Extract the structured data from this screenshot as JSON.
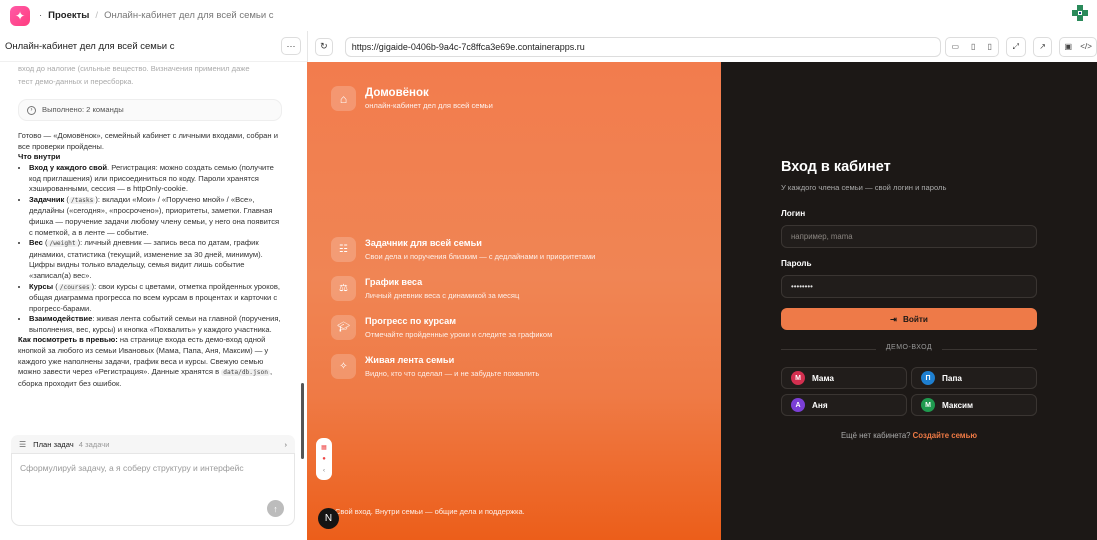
{
  "topbar": {
    "dot": "·",
    "projects": "Проекты",
    "separator": "/",
    "current": "Онлайн-кабинет дел для всей семьи с"
  },
  "left": {
    "title": "Онлайн-кабинет дел для всей семьи с",
    "dots": "···",
    "faded_1": "вход до налогие (сильные вещество. Визначения применил даже",
    "faded_2": "тест демо-данных и пересборка.",
    "done": "Выполнено: 2 команды",
    "intro": "Готово — «Домовёнок», семейный кабинет с личными входами, собран и все проверки пройдены.",
    "what_inside": "Что внутри",
    "items": [
      {
        "bold": "Вход у каждого свой",
        "text": ". Регистрация: можно создать семью (получите код приглашения) или присоединиться по коду. Пароли хранятся хэшированными, сессия — в httpOnly-cookie."
      },
      {
        "bold": "Задачник",
        "code": "/tasks",
        "text": ": вкладки «Мои» / «Поручено мной» / «Все», дедлайны («сегодня», «просрочено»), приоритеты, заметки. Главная фишка — поручение задачи любому члену семьи, у него она появится с пометкой, а в ленте — событие."
      },
      {
        "bold": "Вес",
        "code": "/weight",
        "text": ": личный дневник — запись веса по датам, график динамики, статистика (текущий, изменение за 30 дней, минимум). Цифры видны только владельцу, семья видит лишь событие «записал(а) вес»."
      },
      {
        "bold": "Курсы",
        "code": "/courses",
        "text": ": свои курсы с цветами, отметка пройденных уроков, общая диаграмма прогресса по всем курсам в процентах и карточки с прогресс-барами."
      },
      {
        "bold": "Взаимодействие",
        "text": ": живая лента событий семьи на главной (поручения, выполнения, вес, курсы) и кнопка «Похвалить» у каждого участника."
      }
    ],
    "howto_bold": "Как посмотреть в превью:",
    "howto_text": " на странице входа есть демо-вход одной кнопкой за любого из семьи Ивановых (Мама, Папа, Аня, Максим) — у каждого уже наполнены задачи, график веса и курсы. Свежую семью можно завести через «Регистрация». Данные хранятся в ",
    "howto_code": "data/db.json",
    "howto_end": ", сборка проходит без ошибок.",
    "plan_label": "План задач",
    "plan_count": "4 задачи",
    "input_placeholder": "Сформулируй задачу, а я соберу структуру и интерфейс"
  },
  "browser": {
    "url": "https://gigaide-0406b-9a4c-7c8ffca3e69e.containerapps.ru"
  },
  "brand": {
    "name": "Домовёнок",
    "sub": "онлайн-кабинет дел для всей семьи"
  },
  "features": [
    {
      "icon": "list-icon",
      "title": "Задачник для всей семьи",
      "desc": "Свои дела и поручения близким — с дедлайнами и приоритетами"
    },
    {
      "icon": "scale-icon",
      "title": "График веса",
      "desc": "Личный дневник веса с динамикой за месяц"
    },
    {
      "icon": "graduation-icon",
      "title": "Прогресс по курсам",
      "desc": "Отмечайте пройденные уроки и следите за графиком"
    },
    {
      "icon": "sparkle-icon",
      "title": "Живая лента семьи",
      "desc": "Видно, кто что сделал — и не забудьте похвалить"
    }
  ],
  "footer": "Свой вход. Внутри семьи — общие дела и поддержка.",
  "nbadge": "N",
  "login": {
    "heading": "Вход в кабинет",
    "subtitle": "У каждого члена семьи — свой логин и пароль",
    "login_label": "Логин",
    "login_placeholder": "например, mama",
    "password_label": "Пароль",
    "password_value": "••••••••",
    "button": "Войти",
    "demo_label": "ДЕМО-ВХОД",
    "users": [
      {
        "initial": "М",
        "name": "Мама",
        "color": "#d32f4f"
      },
      {
        "initial": "П",
        "name": "Папа",
        "color": "#1e7fd0"
      },
      {
        "initial": "А",
        "name": "Аня",
        "color": "#7b3fd6"
      },
      {
        "initial": "М",
        "name": "Максим",
        "color": "#1f9a4f"
      }
    ],
    "no_account": "Ещё нет кабинета?",
    "create_link": "Создайте семью"
  },
  "colors": {
    "accent": "#ef7a45",
    "dark_bg": "#1c1816"
  }
}
